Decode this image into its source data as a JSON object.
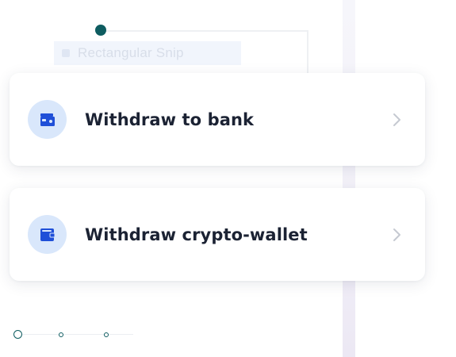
{
  "background_overlay": {
    "snip_label": "Rectangular Snip"
  },
  "options": [
    {
      "label": "Withdraw to bank",
      "icon": "bank-card-icon"
    },
    {
      "label": "Withdraw crypto-wallet",
      "icon": "wallet-icon"
    }
  ],
  "colors": {
    "accent_dark": "#0e5c60",
    "icon_bg": "#d9e7fb",
    "icon_fg": "#1f4fd8",
    "text": "#1b2233",
    "chevron": "#c5c9d1"
  },
  "progress": {
    "steps": 3,
    "current_step": 1
  }
}
